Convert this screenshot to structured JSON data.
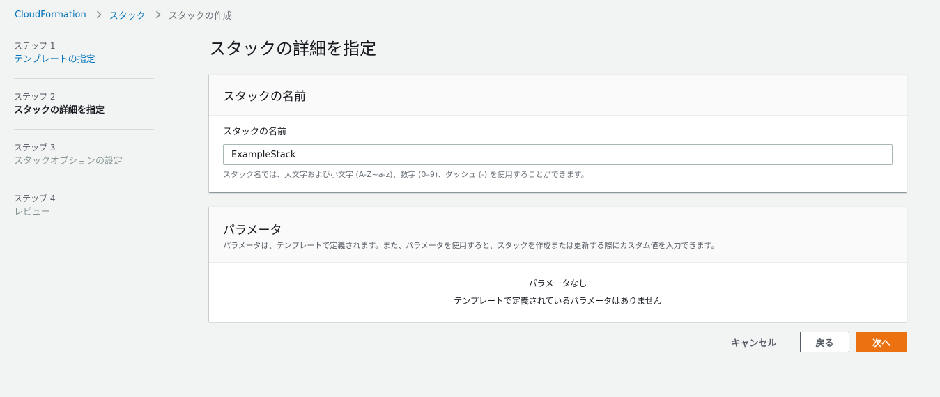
{
  "breadcrumb": {
    "items": [
      "CloudFormation",
      "スタック"
    ],
    "current": "スタックの作成"
  },
  "steps": [
    {
      "num": "ステップ 1",
      "title": "テンプレートの指定"
    },
    {
      "num": "ステップ 2",
      "title": "スタックの詳細を指定"
    },
    {
      "num": "ステップ 3",
      "title": "スタックオプションの設定"
    },
    {
      "num": "ステップ 4",
      "title": "レビュー"
    }
  ],
  "page_title": "スタックの詳細を指定",
  "stack_name_panel": {
    "title": "スタックの名前",
    "field_label": "スタックの名前",
    "value": "ExampleStack",
    "hint": "スタック名では、大文字および小文字 (A-Z~a-z)、数字 (0–9)、ダッシュ (-) を使用することができます。"
  },
  "params_panel": {
    "title": "パラメータ",
    "description": "パラメータは、テンプレートで定義されます。また、パラメータを使用すると、スタックを作成または更新する際にカスタム値を入力できます。",
    "empty_title": "パラメータなし",
    "empty_desc": "テンプレートで定義されているパラメータはありません"
  },
  "actions": {
    "cancel": "キャンセル",
    "back": "戻る",
    "next": "次へ"
  },
  "colors": {
    "link": "#0073bb",
    "primary": "#ec7211",
    "background": "#f2f3f3"
  }
}
